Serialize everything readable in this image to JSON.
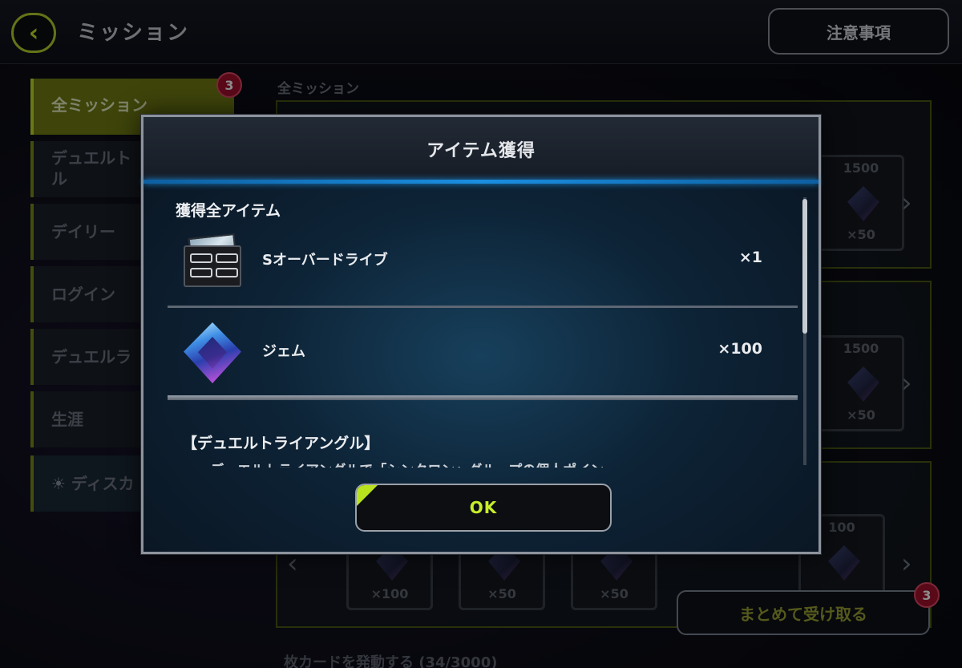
{
  "app": {
    "title": "ミッション",
    "back_icon": "chevron-left-icon",
    "notice_label": "注意事項"
  },
  "sidebar": {
    "badge_count": "3",
    "items": [
      {
        "label": "全ミッション",
        "active": true
      },
      {
        "label": "デュエルト\nル"
      },
      {
        "label": "デイリー"
      },
      {
        "label": "ログイン"
      },
      {
        "label": "デュエルラ"
      },
      {
        "label": "生涯"
      },
      {
        "label": "ディスカ",
        "icon": "lightbulb-icon"
      }
    ]
  },
  "main": {
    "section_label": "全ミッション",
    "rewards_row1": [
      {
        "cost": "1500",
        "value": "×50"
      }
    ],
    "rewards_row2": [
      {
        "cost": "1500",
        "value": "×50"
      }
    ],
    "rewards_row3": [
      {
        "value": "×100"
      },
      {
        "value": "×50"
      },
      {
        "value": "×50"
      },
      {
        "cost": "100",
        "value": ""
      }
    ],
    "collect_all_label": "まとめて受け取る",
    "collect_badge": "3",
    "footer_text": "枚カードを発動する (34/3000)"
  },
  "modal": {
    "title": "アイテム獲得",
    "list_heading": "獲得全アイテム",
    "items": [
      {
        "name": "Sオーバードライブ",
        "qty": "×1",
        "icon": "card-icon"
      },
      {
        "name": "ジェム",
        "qty": "×100",
        "icon": "gem-icon"
      }
    ],
    "desc_title": "【デュエルトライアングル】",
    "desc_text": "・デュエルトライアングルで「シンクロン」グループの個人ポイン",
    "ok_label": "OK"
  },
  "colors": {
    "accent": "#c7ee2a",
    "header_line": "#1b8ee0",
    "badge": "#a5122e"
  }
}
